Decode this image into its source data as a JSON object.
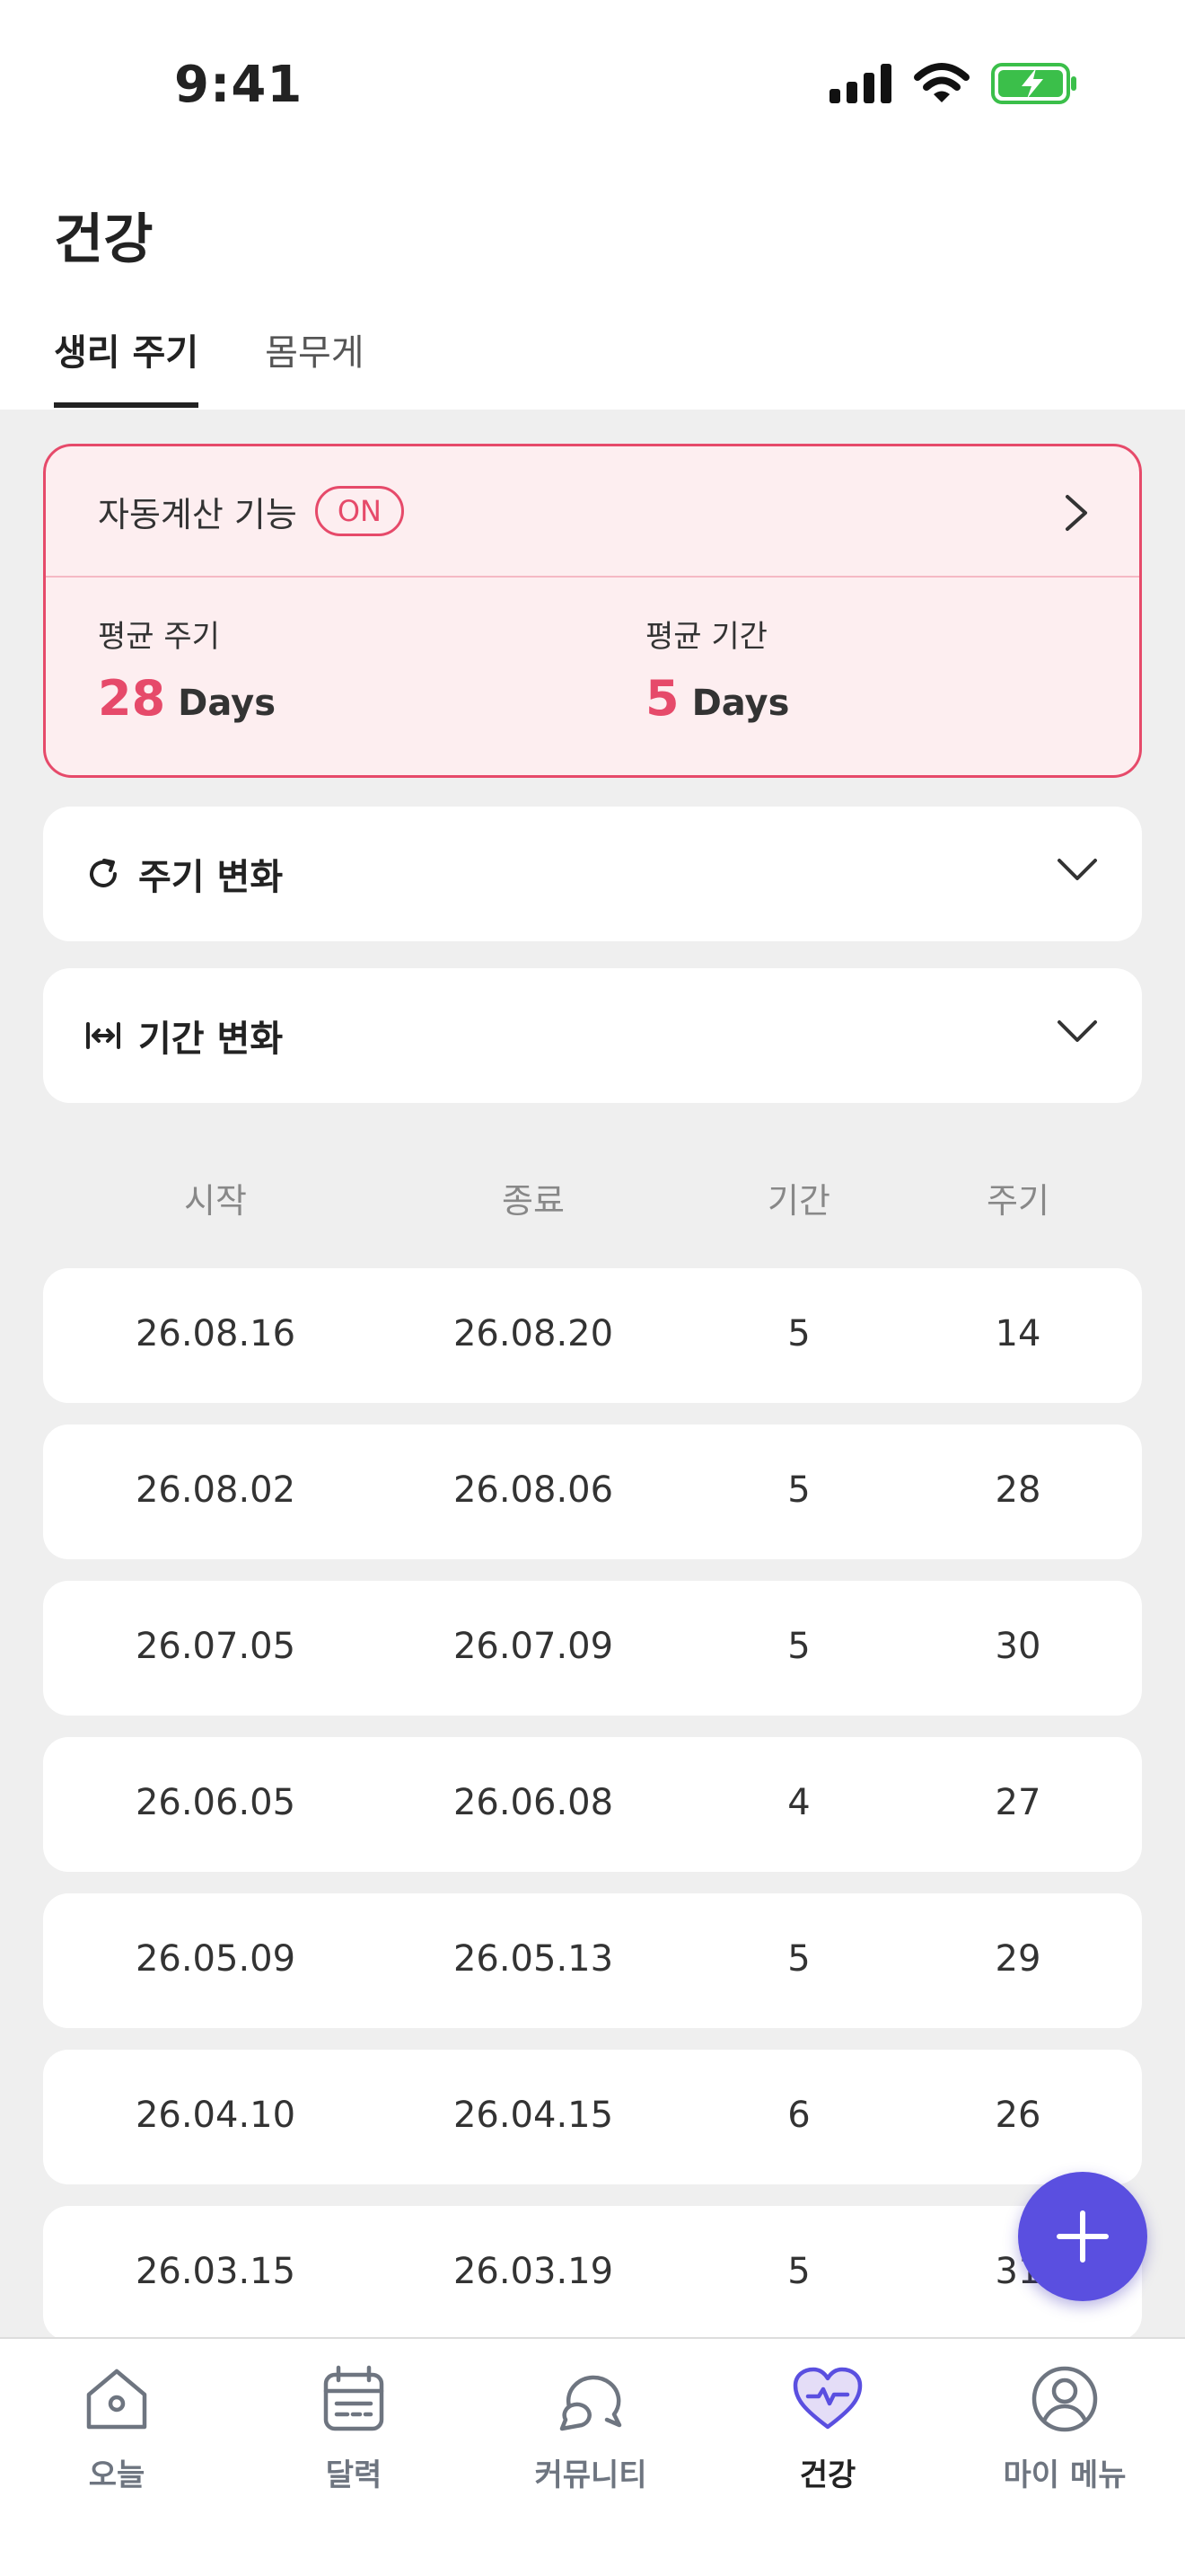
{
  "status_bar": {
    "time": "9:41"
  },
  "header": {
    "title": "건강"
  },
  "tabs": [
    {
      "label": "생리 주기",
      "active": true
    },
    {
      "label": "몸무게",
      "active": false
    }
  ],
  "auto_calc": {
    "label": "자동계산 기능",
    "badge": "ON",
    "avg_cycle_label": "평균 주기",
    "avg_cycle_value": "28",
    "avg_period_label": "평균 기간",
    "avg_period_value": "5",
    "unit": "Days"
  },
  "accordions": [
    {
      "label": "주기 변화",
      "icon": "refresh-icon"
    },
    {
      "label": "기간 변화",
      "icon": "width-arrows-icon"
    }
  ],
  "table": {
    "headers": [
      "시작",
      "종료",
      "기간",
      "주기"
    ],
    "rows": [
      [
        "26.08.16",
        "26.08.20",
        "5",
        "14"
      ],
      [
        "26.08.02",
        "26.08.06",
        "5",
        "28"
      ],
      [
        "26.07.05",
        "26.07.09",
        "5",
        "30"
      ],
      [
        "26.06.05",
        "26.06.08",
        "4",
        "27"
      ],
      [
        "26.05.09",
        "26.05.13",
        "5",
        "29"
      ],
      [
        "26.04.10",
        "26.04.15",
        "6",
        "26"
      ],
      [
        "26.03.15",
        "26.03.19",
        "5",
        "31"
      ]
    ]
  },
  "fab": {
    "icon": "plus-icon"
  },
  "bottom_nav": [
    {
      "label": "오늘",
      "icon": "home-icon",
      "active": false
    },
    {
      "label": "달력",
      "icon": "calendar-icon",
      "active": false
    },
    {
      "label": "커뮤니티",
      "icon": "chat-bubbles-icon",
      "active": false
    },
    {
      "label": "건강",
      "icon": "heart-pulse-icon",
      "active": true
    },
    {
      "label": "마이 메뉴",
      "icon": "profile-icon",
      "active": false
    }
  ],
  "colors": {
    "accent": "#e64a6a",
    "primary": "#5a4fe0",
    "card_bg": "#fdeef0",
    "page_bg": "#efefef"
  }
}
